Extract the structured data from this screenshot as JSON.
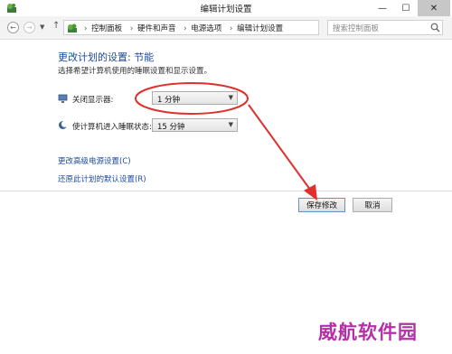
{
  "window": {
    "title": "编辑计划设置",
    "buttons": {
      "minimize": "—",
      "maximize": "☐",
      "close": "✕"
    }
  },
  "address": {
    "breadcrumbs": [
      "控制面板",
      "硬件和声音",
      "电源选项",
      "编辑计划设置"
    ],
    "separator": "›"
  },
  "search": {
    "placeholder": "搜索控制面板"
  },
  "main": {
    "heading": "更改计划的设置: 节能",
    "subtext": "选择希望计算机使用的睡眠设置和显示设置。",
    "display_off": {
      "label": "关闭显示器:",
      "value": "1 分钟"
    },
    "sleep": {
      "label": "使计算机进入睡眠状态:",
      "value": "15 分钟"
    },
    "links": {
      "advanced": "更改高级电源设置(C)",
      "restore": "还原此计划的默认设置(R)"
    }
  },
  "footer": {
    "save_label": "保存修改",
    "cancel_label": "取消"
  },
  "annotation": {
    "color": "#e0302e"
  },
  "watermark": {
    "text": "威航软件园",
    "color": "#b52fa8"
  }
}
